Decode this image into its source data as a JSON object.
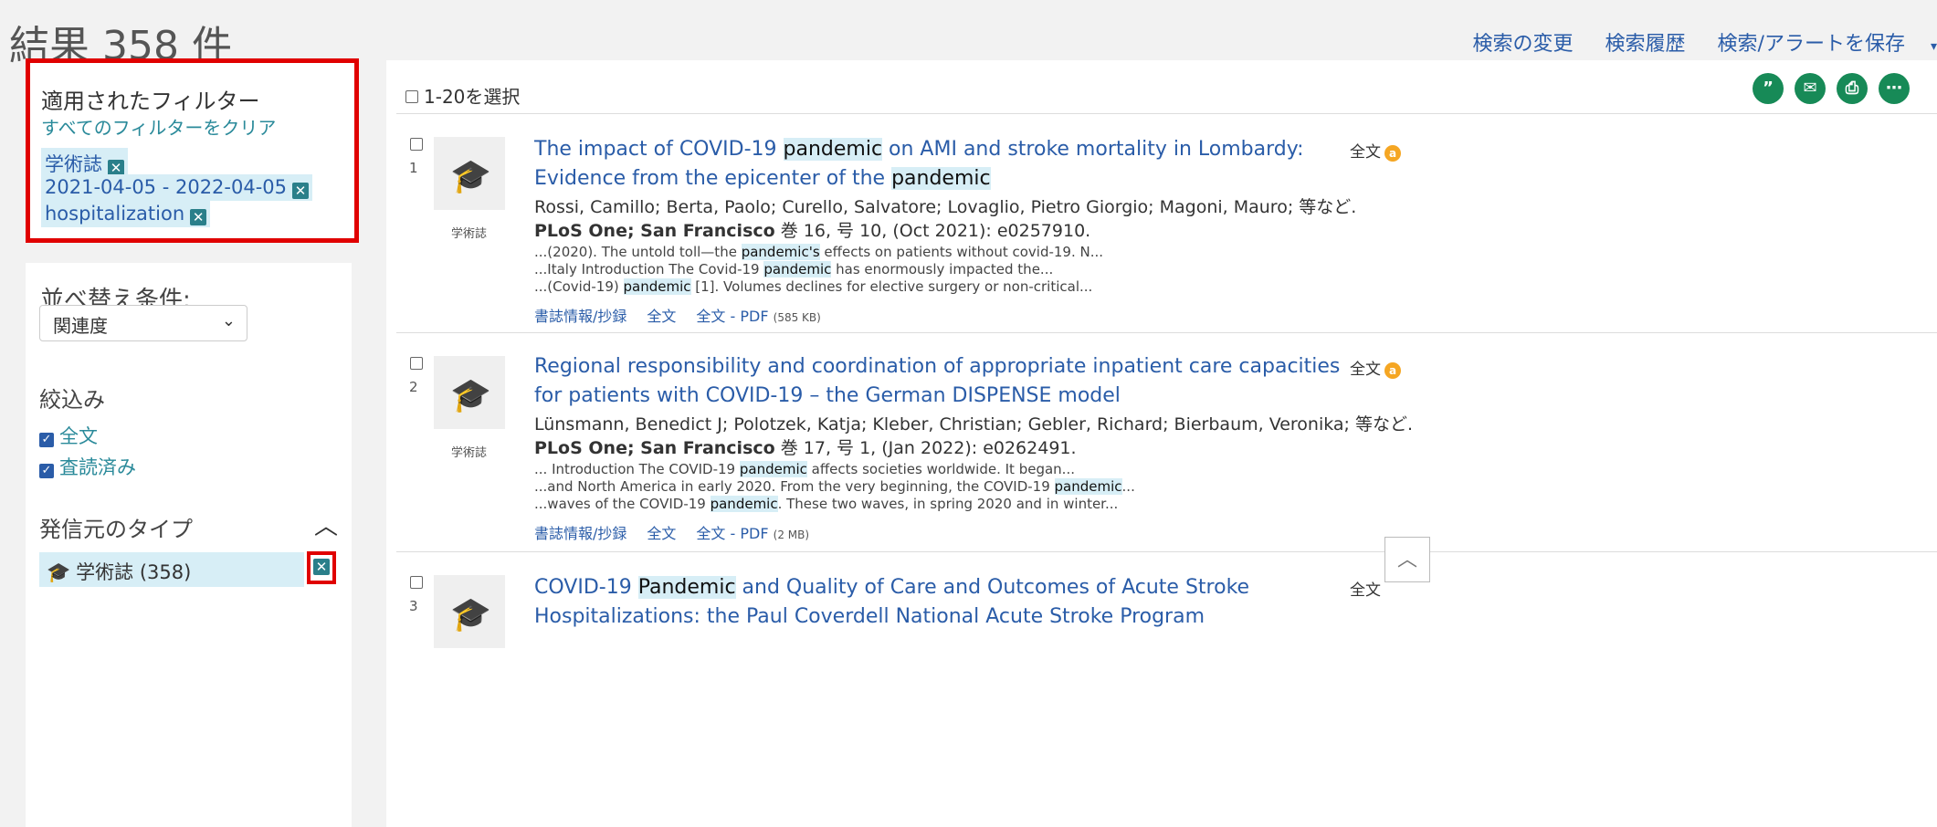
{
  "header": {
    "title": "結果 358 件",
    "links": [
      "検索の変更",
      "検索履歴",
      "検索/アラートを保存"
    ]
  },
  "filters": {
    "title": "適用されたフィルター",
    "clear_all": "すべてのフィルターをクリア",
    "chips": [
      "学術誌",
      "2021-04-05 - 2022-04-05",
      "hospitalization"
    ]
  },
  "sort": {
    "label": "並べ替え条件:",
    "value": "関連度"
  },
  "refine": {
    "label": "絞込み",
    "options": [
      "全文",
      "査読済み"
    ]
  },
  "source_type": {
    "label": "発信元のタイプ",
    "item": "学術誌 (358)"
  },
  "toolbar": {
    "select_all": "1-20を選択",
    "actions": [
      "cite",
      "email",
      "print",
      "more"
    ]
  },
  "results": [
    {
      "num": "1",
      "type": "学術誌",
      "title_parts": [
        "The impact of COVID-19 ",
        "pandemic",
        " on AMI and stroke mortality in Lombardy: Evidence from the epicenter of the ",
        "pandemic"
      ],
      "authors": "Rossi, Camillo; Berta, Paolo; Curello, Salvatore; Lovaglio, Pietro Giorgio; Magoni, Mauro; 等など.",
      "source_bold": "PLoS One; San Francisco",
      "source_rest": " 巻 16, 号 10,  (Oct 2021): e0257910.",
      "snippets": [
        [
          "...(2020). The untold toll—the ",
          "pandemic's",
          " effects on patients without covid-19. N..."
        ],
        [
          "...Italy Introduction The Covid-19 ",
          "pandemic",
          " has enormously impacted the..."
        ],
        [
          "...(Covid-19) ",
          "pandemic",
          " [1]. Volumes declines for elective surgery or non-critical..."
        ]
      ],
      "links": [
        "書誌情報/抄録",
        "全文",
        "全文 - PDF"
      ],
      "pdf_size": "(585 KB)",
      "fulltext": "全文"
    },
    {
      "num": "2",
      "type": "学術誌",
      "title_parts": [
        "Regional responsibility and coordination of appropriate inpatient care capacities for patients with COVID-19 – the German DISPENSE model"
      ],
      "authors": "Lünsmann, Benedict J; Polotzek, Katja; Kleber, Christian; Gebler, Richard; Bierbaum, Veronika; 等など.",
      "source_bold": "PLoS One; San Francisco",
      "source_rest": " 巻 17, 号 1,  (Jan 2022): e0262491.",
      "snippets": [
        [
          "... Introduction The COVID-19 ",
          "pandemic",
          " affects societies worldwide. It began..."
        ],
        [
          "...and North America in early 2020. From the very beginning, the COVID-19 ",
          "pandemic",
          "..."
        ],
        [
          "...waves of the COVID-19 ",
          "pandemic",
          ". These two waves, in spring 2020 and in winter..."
        ]
      ],
      "links": [
        "書誌情報/抄録",
        "全文",
        "全文 - PDF"
      ],
      "pdf_size": "(2 MB)",
      "fulltext": "全文"
    },
    {
      "num": "3",
      "title_parts": [
        "COVID-19 ",
        "Pandemic",
        " and Quality of Care and Outcomes of Acute Stroke Hospitalizations: the Paul Coverdell National Acute Stroke Program"
      ],
      "fulltext": "全文"
    }
  ],
  "scroll_top": "︿"
}
